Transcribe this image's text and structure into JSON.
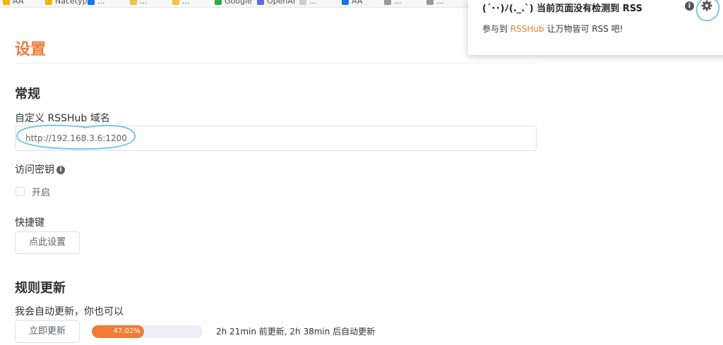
{
  "bookmarks_bar": {
    "items": [
      {
        "label": "AA",
        "color": "#f5b400"
      },
      {
        "label": "Nacetype",
        "color": "#f5b400"
      },
      {
        "label": "...",
        "color": "#1a73e8"
      },
      {
        "label": "...",
        "color": "#f5c242"
      },
      {
        "label": "...",
        "color": "#f5c242"
      },
      {
        "label": "Google",
        "color": "#34a853"
      },
      {
        "label": "OpenAI",
        "color": "#5b6ee1"
      },
      {
        "label": "...",
        "color": "#cccccc"
      },
      {
        "label": "AA",
        "color": "#1a73e8"
      },
      {
        "label": "...",
        "color": "#999999"
      },
      {
        "label": "...",
        "color": "#999999"
      }
    ]
  },
  "page": {
    "title": "设置"
  },
  "general": {
    "heading": "常规",
    "rsshub_domain_label": "自定义 RSSHub 域名",
    "rsshub_domain_value": "http://192.168.3.6:1200",
    "access_key_label": "访问密钥",
    "access_key_enable_label": "开启",
    "shortcut_label": "快捷键",
    "shortcut_button": "点此设置"
  },
  "rule_update": {
    "heading": "规则更新",
    "description": "我会自动更新，你也可以",
    "update_now_button": "立即更新",
    "progress_percent": 47.02,
    "progress_text": "47.02%",
    "status_text": "2h 21min 前更新, 2h 38min 后自动更新"
  },
  "popup": {
    "title": "(´･･)ﾉ(._.`) 当前页面没有检测到 RSS",
    "message_prefix": "参与到 ",
    "message_link": "RSSHub",
    "message_suffix": " 让万物皆可 RSS 吧!",
    "info_icon_glyph": "i",
    "gear_icon": "gear-icon"
  },
  "colors": {
    "accent": "#f07c33",
    "annotation": "#7cc6ea"
  }
}
